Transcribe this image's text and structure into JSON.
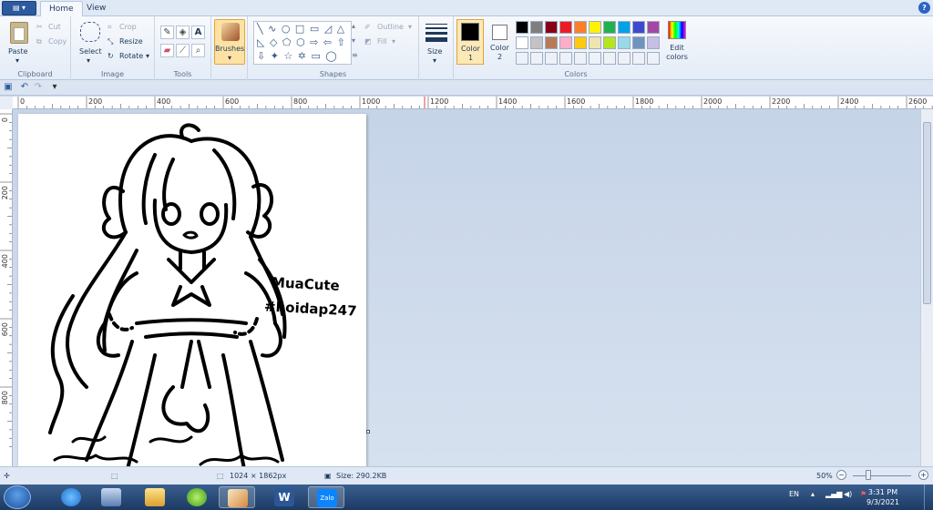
{
  "tabs": {
    "home": "Home",
    "view": "View"
  },
  "clipboard": {
    "paste": "Paste",
    "cut": "Cut",
    "copy": "Copy",
    "label": "Clipboard"
  },
  "image": {
    "select": "Select",
    "crop": "Crop",
    "resize": "Resize",
    "rotate": "Rotate",
    "label": "Image"
  },
  "tools": {
    "label": "Tools"
  },
  "brushes": {
    "label": "Brushes"
  },
  "shapes": {
    "outline": "Outline",
    "fill": "Fill",
    "label": "Shapes"
  },
  "size": {
    "label": "Size"
  },
  "colors": {
    "color1": "Color 1",
    "color2": "Color 2",
    "edit": "Edit colors",
    "label": "Colors",
    "palette_row1": [
      "#000000",
      "#7f7f7f",
      "#880015",
      "#ed1c24",
      "#ff7f27",
      "#fff200",
      "#22b14c",
      "#00a2e8",
      "#3f48cc",
      "#a349a4"
    ],
    "palette_row2": [
      "#ffffff",
      "#c3c3c3",
      "#b97a57",
      "#ffaec9",
      "#ffc90e",
      "#efe4b0",
      "#b5e61d",
      "#99d9ea",
      "#7092be",
      "#c8bfe7"
    ]
  },
  "ruler": {
    "h_ticks": [
      "0",
      "200",
      "400",
      "600",
      "800",
      "1000",
      "1200",
      "1400",
      "1600",
      "1800",
      "2000",
      "2200",
      "2400",
      "2600"
    ],
    "v_ticks": [
      "0",
      "200",
      "400",
      "600",
      "800"
    ]
  },
  "drawing": {
    "text_line1": "MuaCute",
    "text_line2": "#hoidap247"
  },
  "status": {
    "dimensions": "1024 × 1862px",
    "size": "Size: 290.2KB",
    "zoom": "50%"
  },
  "tray": {
    "lang": "EN",
    "time": "3:31 PM",
    "date": "9/3/2021"
  },
  "taskbar": {
    "zalo": "Zalo"
  }
}
